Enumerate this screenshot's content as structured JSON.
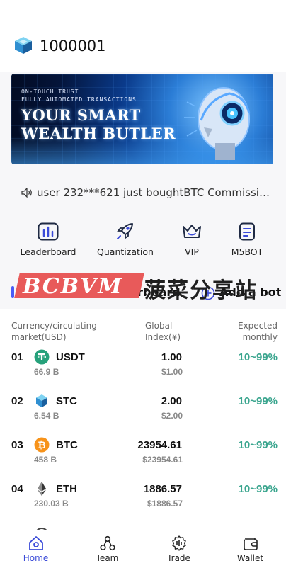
{
  "header": {
    "account_id": "1000001",
    "logo_icon": "cube-logo-icon"
  },
  "banner": {
    "kicker_line1": "ON-TOUCH TRUST",
    "kicker_line2": "FULLY AUTOMATED TRANSACTIONS",
    "headline_line1": "YOUR SMART",
    "headline_line2": "WEALTH BUTLER"
  },
  "notice": {
    "icon": "speaker-icon",
    "text": "user 232***621 just boughtBTC Commission p..."
  },
  "quick_menu": [
    {
      "label": "Leaderboard",
      "icon": "bar-chart-icon"
    },
    {
      "label": "Quantization",
      "icon": "rocket-icon"
    },
    {
      "label": "VIP",
      "icon": "crown-icon"
    },
    {
      "label": "M5BOT",
      "icon": "document-icon"
    }
  ],
  "watermark": {
    "latin": "BCBVM",
    "chinese": "菠菜分享站"
  },
  "leaderboard": {
    "title": "Quantitative leaderboard",
    "add_bot_label": "Add a bot",
    "columns": {
      "currency_line1": "Currency/circulating",
      "currency_line2": "market(USD)",
      "index_line1": "Global",
      "index_line2": "Index(¥)",
      "expected_line1": "Expected",
      "expected_line2": "monthly"
    },
    "rows": [
      {
        "rank": "01",
        "symbol": "USDT",
        "market_cap": "66.9 B",
        "price": "1.00",
        "price_usd": "$1.00",
        "expected": "10~99%",
        "icon": "tether-icon"
      },
      {
        "rank": "02",
        "symbol": "STC",
        "market_cap": "6.54 B",
        "price": "2.00",
        "price_usd": "$2.00",
        "expected": "10~99%",
        "icon": "cube-coin-icon"
      },
      {
        "rank": "03",
        "symbol": "BTC",
        "market_cap": "458 B",
        "price": "23954.61",
        "price_usd": "$23954.61",
        "expected": "10~99%",
        "icon": "bitcoin-icon"
      },
      {
        "rank": "04",
        "symbol": "ETH",
        "market_cap": "230.03 B",
        "price": "1886.57",
        "price_usd": "$1886.57",
        "expected": "10~99%",
        "icon": "ethereum-icon"
      }
    ]
  },
  "tabbar": [
    {
      "label": "Home",
      "icon": "home-icon",
      "active": true
    },
    {
      "label": "Team",
      "icon": "team-icon",
      "active": false
    },
    {
      "label": "Trade",
      "icon": "trade-icon",
      "active": false
    },
    {
      "label": "Wallet",
      "icon": "wallet-icon",
      "active": false
    }
  ],
  "colors": {
    "accent": "#4a5bf6",
    "positive": "#3aa58e",
    "active_tab": "#3b4bd8"
  }
}
